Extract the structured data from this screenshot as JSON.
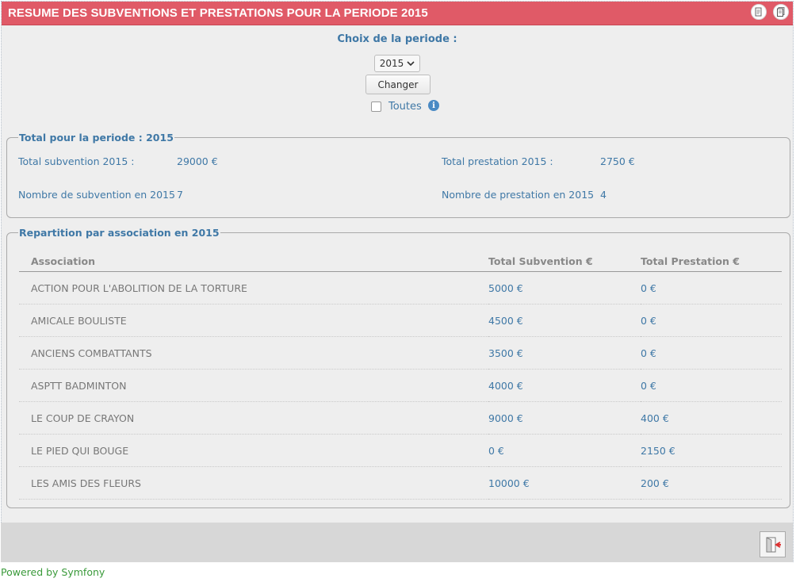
{
  "window": {
    "title": "RESUME DES SUBVENTIONS ET PRESTATIONS POUR LA PERIODE 2015",
    "title_buttons": [
      {
        "icon": "pdf-export-icon"
      },
      {
        "icon": "print-document-icon"
      }
    ]
  },
  "periode": {
    "label": "Choix de la periode :",
    "selected_year": "2015",
    "change_button": "Changer",
    "all_label": "Toutes",
    "all_checked": false
  },
  "totals": {
    "legend": "Total pour la periode : 2015",
    "subvention_label": "Total subvention 2015 :",
    "subvention_value": "29000 €",
    "prestation_label": "Total prestation 2015 :",
    "prestation_value": "2750 €",
    "nb_subvention_label": "Nombre de subvention en 2015",
    "nb_subvention_value": "7",
    "nb_prestation_label": "Nombre de prestation en 2015",
    "nb_prestation_value": "4"
  },
  "repartition": {
    "legend": "Repartition par association en 2015",
    "columns": [
      "Association",
      "Total Subvention €",
      "Total Prestation €"
    ],
    "rows": [
      {
        "association": "ACTION POUR L'ABOLITION DE LA TORTURE",
        "subvention": "5000 €",
        "prestation": "0 €"
      },
      {
        "association": "AMICALE BOULISTE",
        "subvention": "4500 €",
        "prestation": "0 €"
      },
      {
        "association": "ANCIENS COMBATTANTS",
        "subvention": "3500 €",
        "prestation": "0 €"
      },
      {
        "association": "ASPTT BADMINTON",
        "subvention": "4000 €",
        "prestation": "0 €"
      },
      {
        "association": "LE COUP DE CRAYON",
        "subvention": "9000 €",
        "prestation": "400 €"
      },
      {
        "association": "LE PIED QUI BOUGE",
        "subvention": "0 €",
        "prestation": "2150 €"
      },
      {
        "association": "LES AMIS DES FLEURS",
        "subvention": "10000 €",
        "prestation": "200 €"
      }
    ]
  },
  "footer": {
    "powered_by": "Powered by Symfony",
    "logout_icon": "logout-door-icon"
  },
  "colors": {
    "titlebar": "#e05a67",
    "accent_text": "#3f78a6",
    "footer_link": "#3a9a3a"
  }
}
